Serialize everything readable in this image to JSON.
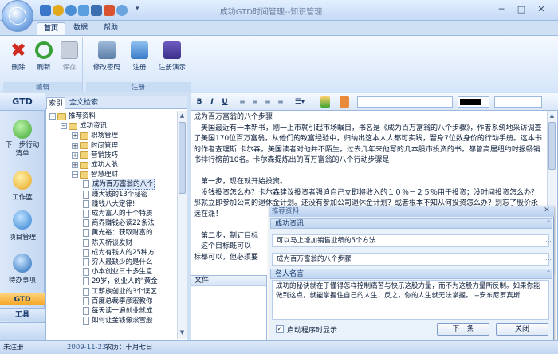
{
  "app": {
    "title": "成功GTD时间管理--知识管理"
  },
  "ribbon": {
    "tabs": [
      "首页",
      "数据",
      "帮助"
    ],
    "groups": [
      {
        "label": "编辑",
        "buttons": [
          "删除",
          "刷新",
          "保存"
        ]
      },
      {
        "label": "注册",
        "buttons": [
          "修改密码",
          "注册",
          "注册演示"
        ]
      }
    ]
  },
  "nav": {
    "header": "GTD",
    "items": [
      "下一步行动清单",
      "工作篮",
      "项目管理",
      "待办事项"
    ],
    "bottom_tabs": [
      "GTD",
      "工具"
    ]
  },
  "tree": {
    "tabs": [
      "索引",
      "全文检索"
    ],
    "nodes": [
      {
        "label": "推荐资料",
        "level": 0,
        "type": "folder",
        "expanded": true
      },
      {
        "label": "成功资讯",
        "level": 1,
        "type": "folder",
        "expanded": true
      },
      {
        "label": "职场管理",
        "level": 2,
        "type": "folder",
        "expanded": false
      },
      {
        "label": "时间管理",
        "level": 2,
        "type": "folder",
        "expanded": false
      },
      {
        "label": "营销技巧",
        "level": 2,
        "type": "folder",
        "expanded": false
      },
      {
        "label": "成功人脉",
        "level": 2,
        "type": "folder",
        "expanded": false
      },
      {
        "label": "智慧理财",
        "level": 2,
        "type": "folder",
        "expanded": true
      },
      {
        "label": "成为百万富翁的八个",
        "level": 3,
        "type": "doc",
        "selected": true
      },
      {
        "label": "赚大钱的13个秘密",
        "level": 3,
        "type": "doc"
      },
      {
        "label": "赚钱八大定律!",
        "level": 3,
        "type": "doc"
      },
      {
        "label": "成为富人的十个特质",
        "level": 3,
        "type": "doc"
      },
      {
        "label": "商界赚钱必读22条法",
        "level": 3,
        "type": "doc"
      },
      {
        "label": "黄光裕：获取财富的",
        "level": 3,
        "type": "doc"
      },
      {
        "label": "陈天桥谈发财",
        "level": 3,
        "type": "doc"
      },
      {
        "label": "成为有钱人的25种方",
        "level": 3,
        "type": "doc"
      },
      {
        "label": "穷人最缺少的是什么",
        "level": 3,
        "type": "doc"
      },
      {
        "label": "小本创业三十多生意",
        "level": 3,
        "type": "doc"
      },
      {
        "label": "29岁，创业人的\"黄金",
        "level": 3,
        "type": "doc"
      },
      {
        "label": "工薪族创业的3个误区",
        "level": 3,
        "type": "doc"
      },
      {
        "label": "百度总裁李彦宏教你",
        "level": 3,
        "type": "doc"
      },
      {
        "label": "每天读一遍创业就成",
        "level": 3,
        "type": "doc"
      },
      {
        "label": "如何让金钱像滚雪般",
        "level": 3,
        "type": "doc"
      }
    ]
  },
  "editor": {
    "toolbar": [
      "B",
      "I",
      "U",
      "≡",
      "≡",
      "≡",
      "≡"
    ],
    "color": "#000000",
    "paragraphs": [
      "成为百万富翁的八个步骤",
      "　美国最近有一本新书，刚一上市就引起市场瞩目，书名是《成为百万富翁的八个步骤》，作者系统地采访调查了美国170位百万富翁，从他们的致富经验中，归纳出这本人人都可实践，晋身7位数身价的行动手册。这本书的作者查理斯·卡尔森，美国读者对他并不陌生，过去几年来他写的几本股市投资的书，都曾高居纽约时报畅销书排行榜前10名。卡尔森提炼出的百万富翁的八个行动步骤是",
      "",
      "　第一步，现在就开始投资。",
      "　没钱投资怎么办？卡尔森建议投资者强迫自己立即将收入的１０％－２５％用于投资；没时间投资怎么办？那就立即参加公司的退休金计划。还没有参加公司退休金计划？或者根本不知从何投资怎么办？别忘了股价永远在涨！",
      "",
      "　第二步，制订目标",
      "　这个目标既可以",
      "标都可以，但必须要"
    ],
    "file_label": "文件"
  },
  "popup": {
    "title": "推荐资料",
    "section1": "成功资讯",
    "items": [
      "可以马上增加销售业绩的5个方法",
      "成为百万富翁的八个步骤"
    ],
    "section2": "名人名言",
    "quote": "成功的秘诀就在于懂得怎样控制痛苦与快乐这股力量，而不为这股力量所反制。如果你能做到这点，就能掌握住自己的人生，反之，你的人生就无法掌握。 --安东尼罗宾斯",
    "checkbox_label": "启动程序时显示",
    "checkbox_checked": true,
    "next_button": "下一条",
    "close_button": "关闭"
  },
  "status": {
    "left": "未注册",
    "date": "2009-11-23",
    "lunar": "农历：十月七日"
  }
}
